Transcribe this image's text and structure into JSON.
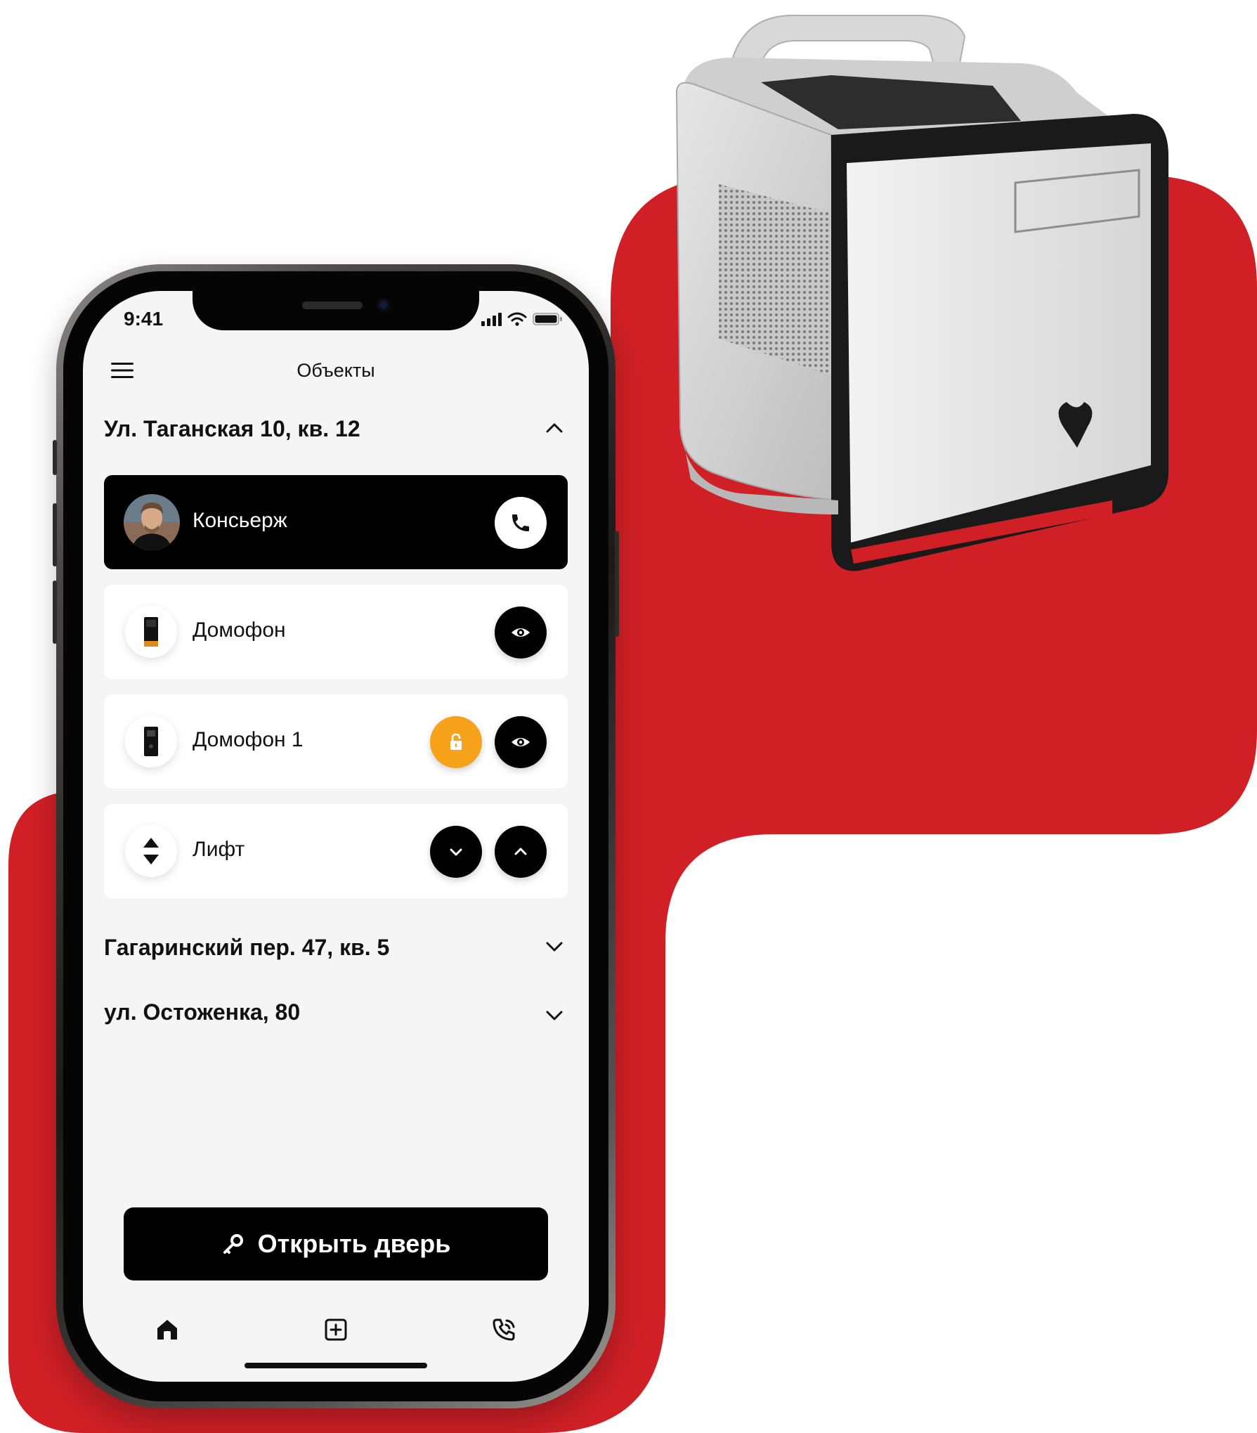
{
  "status_bar": {
    "time": "9:41"
  },
  "header": {
    "title": "Объекты"
  },
  "sections": [
    {
      "title": "Ул. Таганская 10, кв. 12",
      "expanded": true
    },
    {
      "title": "Гагаринский пер. 47, кв. 5",
      "expanded": false
    },
    {
      "title": "ул. Остоженка, 80",
      "expanded": false
    }
  ],
  "rows": [
    {
      "label": "Консьерж",
      "icon": "avatar",
      "actions": [
        "phone-icon"
      ]
    },
    {
      "label": "Домофон",
      "icon": "intercom-icon",
      "actions": [
        "eye-icon"
      ]
    },
    {
      "label": "Домофон 1",
      "icon": "intercom-icon",
      "actions": [
        "unlock-icon",
        "eye-icon"
      ]
    },
    {
      "label": "Лифт",
      "icon": "elevator-icon",
      "actions": [
        "chevron-down-icon",
        "chevron-up-icon"
      ]
    }
  ],
  "cta": {
    "label": "Открыть дверь",
    "icon": "key-icon"
  },
  "tabs": [
    {
      "icon": "home-icon"
    },
    {
      "icon": "add-square-icon"
    },
    {
      "icon": "phone-call-icon"
    }
  ],
  "colors": {
    "brand_red": "#d02026",
    "accent_orange": "#f7a21b",
    "dark": "#000000",
    "screen_bg": "#f5f5f5"
  }
}
